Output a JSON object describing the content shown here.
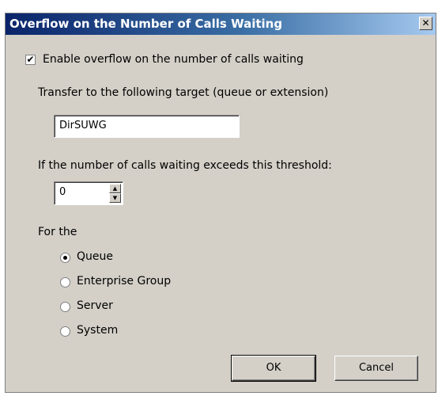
{
  "dialog": {
    "title": "Overflow on the Number of Calls Waiting",
    "close_label": "✕"
  },
  "enable_overflow": {
    "checked": true,
    "label": "Enable overflow on the number of calls waiting"
  },
  "target": {
    "label": "Transfer to the following target (queue or extension)",
    "value": "DirSUWG"
  },
  "threshold": {
    "label": "If the number of calls waiting exceeds this threshold:",
    "value": "0"
  },
  "scope": {
    "label": "For the",
    "options": [
      {
        "label": "Queue",
        "selected": true
      },
      {
        "label": "Enterprise Group",
        "selected": false
      },
      {
        "label": "Server",
        "selected": false
      },
      {
        "label": "System",
        "selected": false
      }
    ]
  },
  "buttons": {
    "ok": "OK",
    "cancel": "Cancel"
  }
}
